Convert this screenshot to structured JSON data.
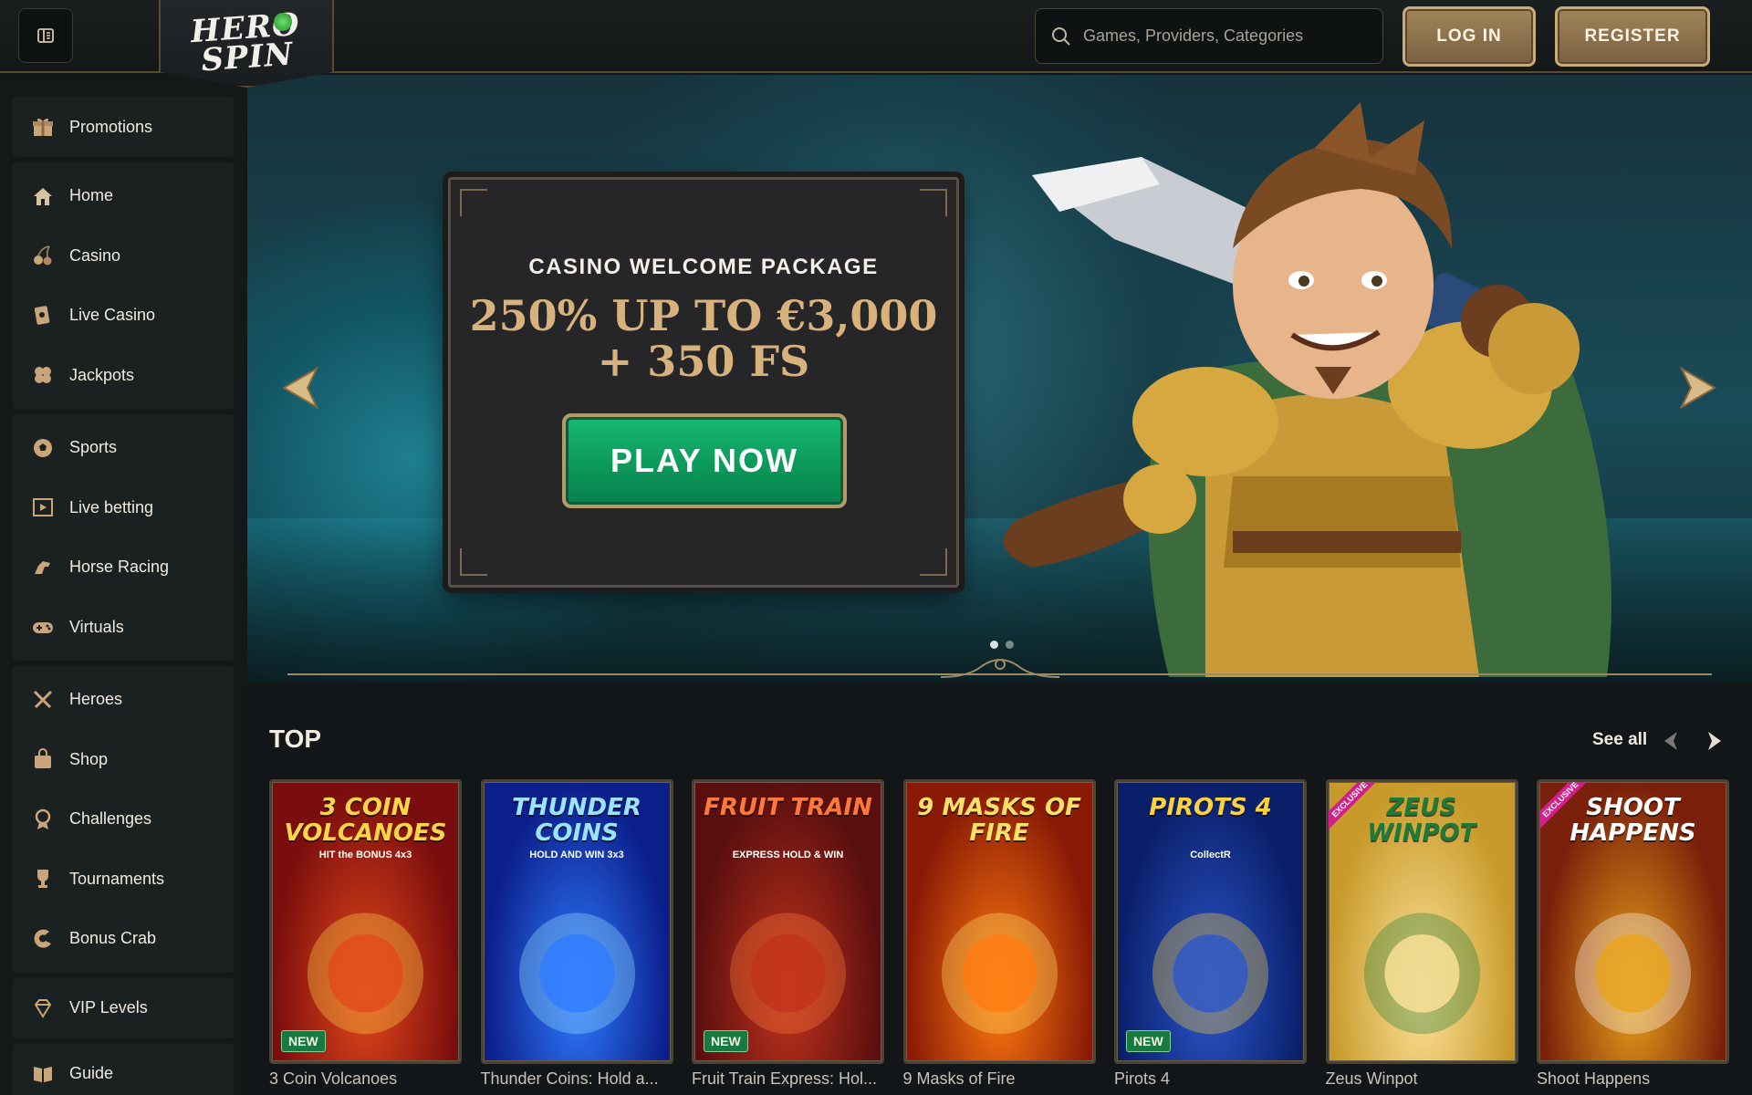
{
  "header": {
    "menu_icon": "menu-icon",
    "logo_text_line1": "HERO",
    "logo_text_line2": "SPIN",
    "search_placeholder": "Games, Providers, Categories",
    "login_label": "LOG IN",
    "register_label": "REGISTER"
  },
  "sidebar": {
    "groups": [
      [
        {
          "label": "Promotions",
          "icon": "gift-icon"
        }
      ],
      [
        {
          "label": "Home",
          "icon": "home-icon"
        },
        {
          "label": "Casino",
          "icon": "cherries-icon"
        },
        {
          "label": "Live Casino",
          "icon": "live-casino-icon"
        },
        {
          "label": "Jackpots",
          "icon": "clover-icon"
        }
      ],
      [
        {
          "label": "Sports",
          "icon": "soccer-ball-icon"
        },
        {
          "label": "Live betting",
          "icon": "live-betting-icon"
        },
        {
          "label": "Horse Racing",
          "icon": "horse-icon"
        },
        {
          "label": "Virtuals",
          "icon": "gamepad-icon"
        }
      ],
      [
        {
          "label": "Heroes",
          "icon": "crossed-swords-icon"
        },
        {
          "label": "Shop",
          "icon": "shopping-bag-icon"
        },
        {
          "label": "Challenges",
          "icon": "medal-icon"
        },
        {
          "label": "Tournaments",
          "icon": "trophy-icon"
        },
        {
          "label": "Bonus Crab",
          "icon": "crab-icon"
        }
      ],
      [
        {
          "label": "VIP Levels",
          "icon": "diamond-icon"
        }
      ],
      [
        {
          "label": "Guide",
          "icon": "book-icon"
        }
      ]
    ]
  },
  "hero": {
    "eyebrow": "CASINO WELCOME PACKAGE",
    "amount_line1": "250% UP TO €3,000",
    "amount_line2": "+ 350 FS",
    "cta_label": "PLAY NOW",
    "slides_count": 2,
    "active_slide": 1
  },
  "top_section": {
    "title": "TOP",
    "see_all_label": "See all",
    "games": [
      {
        "name": "3 Coin Volcanoes",
        "tile_title": "3 COIN VOLCANOES",
        "tile_sub": "HIT the BONUS 4x3",
        "badge": "NEW",
        "exclusive": false,
        "bg1": "#7a0d0d",
        "bg2": "#e2481a",
        "title_color": "#ffd54a"
      },
      {
        "name": "Thunder Coins: Hold a...",
        "tile_title": "THUNDER COINS",
        "tile_sub": "HOLD AND WIN 3x3",
        "badge": "",
        "exclusive": false,
        "bg1": "#0b1e8a",
        "bg2": "#2f7bff",
        "title_color": "#9be3ff"
      },
      {
        "name": "Fruit Train Express: Hol...",
        "tile_title": "FRUIT TRAIN",
        "tile_sub": "EXPRESS HOLD & WIN",
        "badge": "NEW",
        "exclusive": false,
        "bg1": "#5a0f0f",
        "bg2": "#c0321c",
        "title_color": "#ff7a3a"
      },
      {
        "name": "9 Masks of Fire",
        "tile_title": "9 MASKS OF FIRE",
        "tile_sub": "",
        "badge": "",
        "exclusive": false,
        "bg1": "#8a1a05",
        "bg2": "#ff7a10",
        "title_color": "#ffe16a"
      },
      {
        "name": "Pirots 4",
        "tile_title": "PIROTS 4",
        "tile_sub": "CollectR",
        "badge": "NEW",
        "exclusive": false,
        "bg1": "#0a1f6a",
        "bg2": "#2b56c9",
        "title_color": "#ffd23a"
      },
      {
        "name": "Zeus Winpot",
        "tile_title": "ZEUS WINPOT",
        "tile_sub": "",
        "badge": "",
        "exclusive": true,
        "exclusive_label": "EXCLUSIVE",
        "bg1": "#c79a2a",
        "bg2": "#ffe39a",
        "title_color": "#1f7a3a"
      },
      {
        "name": "Shoot Happens",
        "tile_title": "SHOOT HAPPENS",
        "tile_sub": "",
        "badge": "",
        "exclusive": true,
        "exclusive_label": "EXCLUSIVE",
        "bg1": "#7a1f0a",
        "bg2": "#e8a21a",
        "title_color": "#ffffff"
      }
    ]
  },
  "colors": {
    "accent_gold": "#c8ab7a",
    "cta_green": "#0fa060",
    "background": "#121618"
  }
}
